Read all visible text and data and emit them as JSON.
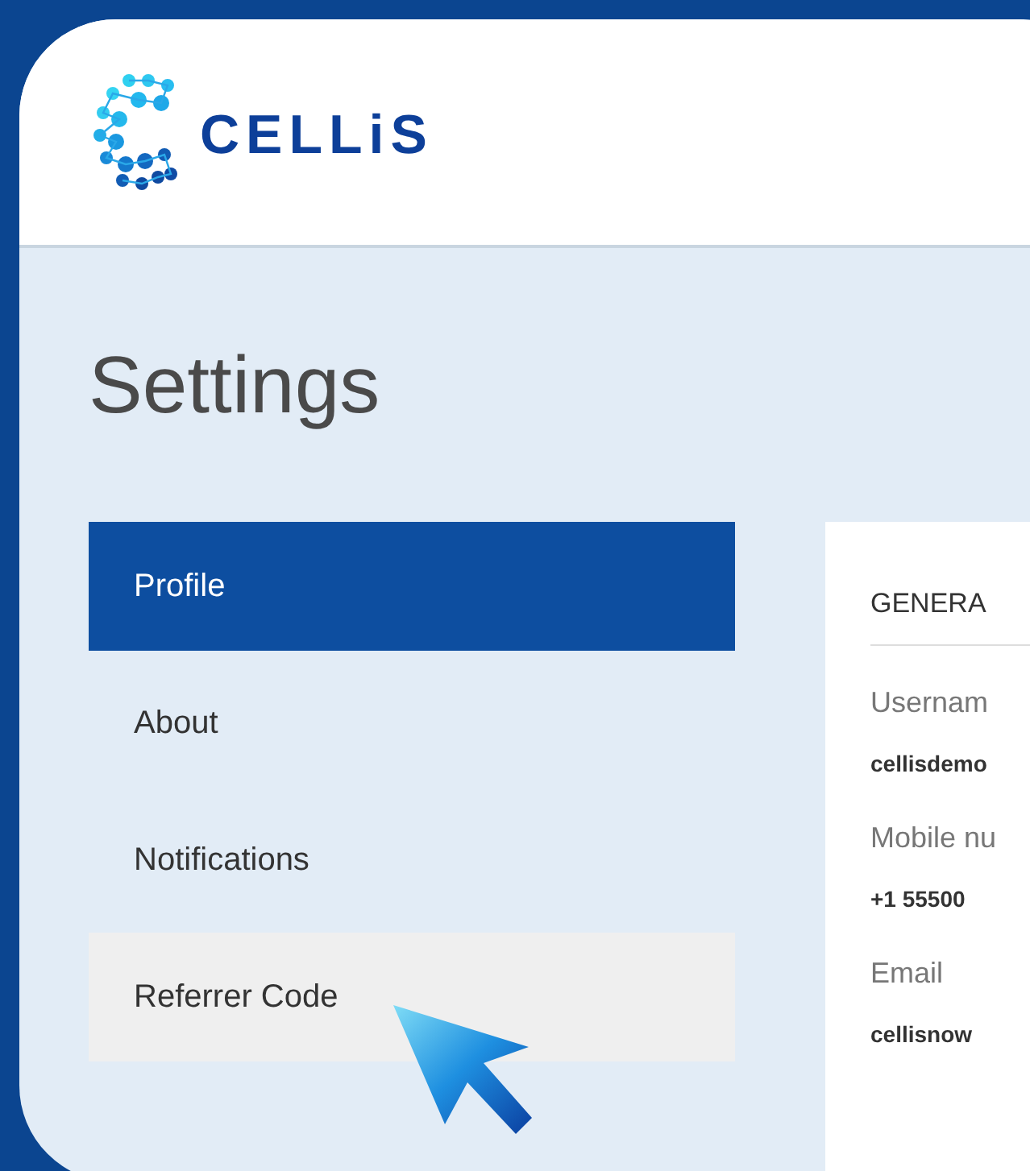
{
  "logo": {
    "text": "CELLiS"
  },
  "page_title": "Settings",
  "sidebar": {
    "items": [
      {
        "label": "Profile",
        "selected": true,
        "hovered": false
      },
      {
        "label": "About",
        "selected": false,
        "hovered": false
      },
      {
        "label": "Notifications",
        "selected": false,
        "hovered": false
      },
      {
        "label": "Referrer Code",
        "selected": false,
        "hovered": true
      }
    ]
  },
  "card": {
    "heading": "GENERA",
    "fields": [
      {
        "label": "Usernam",
        "value": "cellisdemo"
      },
      {
        "label": "Mobile nu",
        "value": "+1 55500"
      },
      {
        "label": "Email",
        "value": "cellisnow"
      }
    ]
  }
}
